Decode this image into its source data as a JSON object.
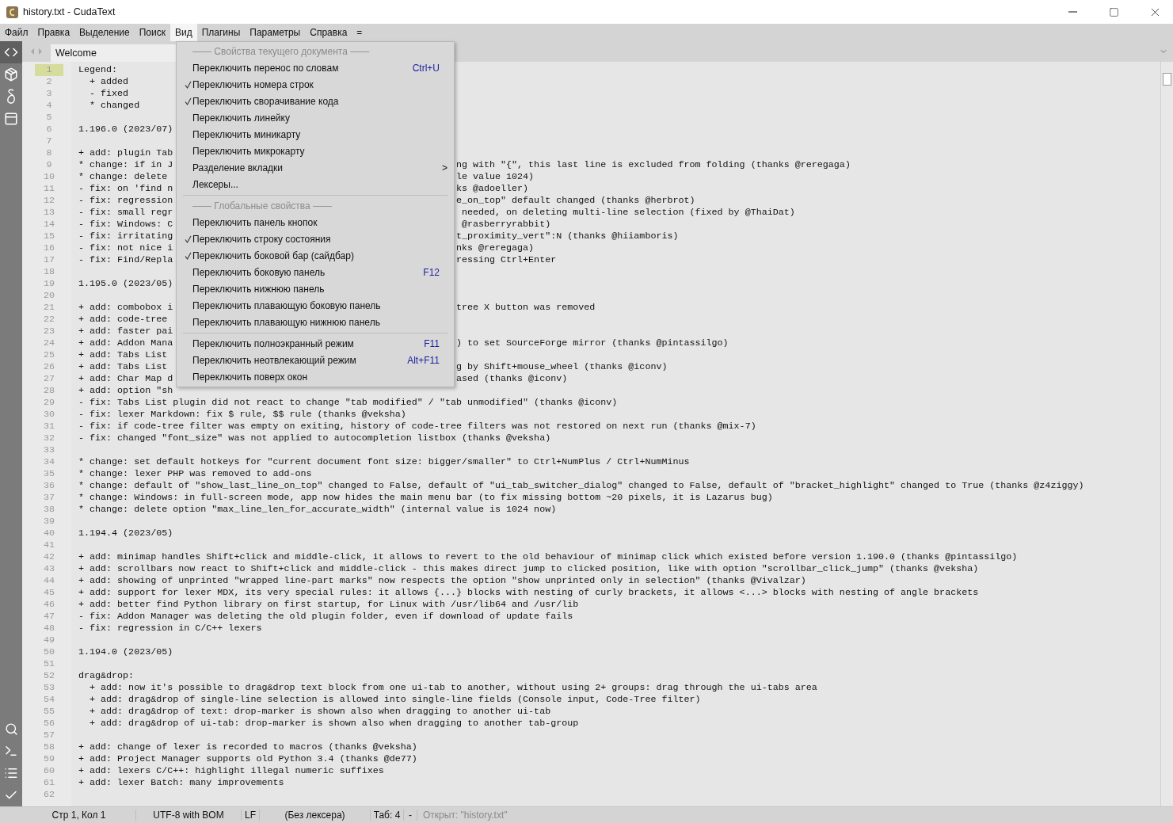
{
  "window": {
    "title": "history.txt - CudaText"
  },
  "menu_bar": [
    {
      "label": "Файл",
      "selected": false
    },
    {
      "label": "Правка",
      "selected": false
    },
    {
      "label": "Выделение",
      "selected": false
    },
    {
      "label": "Поиск",
      "selected": false
    },
    {
      "label": "Вид",
      "selected": true
    },
    {
      "label": "Плагины",
      "selected": false
    },
    {
      "label": "Параметры",
      "selected": false
    },
    {
      "label": "Справка",
      "selected": false
    },
    {
      "label": "=",
      "selected": false
    }
  ],
  "tabs": [
    {
      "label": "Welcome",
      "selected": true
    }
  ],
  "lines": [
    {
      "number": "1",
      "text": "Legend:",
      "current": true
    },
    {
      "number": "2",
      "text": "  + added",
      "current": false
    },
    {
      "number": "3",
      "text": "  - fixed",
      "current": false
    },
    {
      "number": "4",
      "text": "  * changed",
      "current": false
    },
    {
      "number": "5",
      "current": false
    },
    {
      "number": "6",
      "text": "1.196.0 (2023/07)",
      "current": false
    },
    {
      "number": "7",
      "current": false
    },
    {
      "number": "8",
      "text": "+ add: plugin Tab",
      "current": false
    },
    {
      "number": "9",
      "text": "* change: if in J",
      "tail": "ng with \"{\", this last line is excluded from folding (thanks @reregaga)",
      "current": false
    },
    {
      "number": "10",
      "text": "* change: delete",
      "tail": "le value 1024)",
      "current": false
    },
    {
      "number": "11",
      "text": "- fix: on 'find n",
      "tail": "ks @adoeller)",
      "current": false
    },
    {
      "number": "12",
      "text": "- fix: regression",
      "tail": "e_on_top\" default changed (thanks @herbrot)",
      "current": false
    },
    {
      "number": "13",
      "text": "- fix: small regr",
      "tail": " needed, on deleting multi-line selection (fixed by @ThaiDat)",
      "current": false
    },
    {
      "number": "14",
      "text": "- fix: Windows: C",
      "tail": " @rasberryrabbit)",
      "current": false
    },
    {
      "number": "15",
      "text": "- fix: irritating",
      "tail": "t_proximity_vert\":N (thanks @hiiamboris)",
      "current": false
    },
    {
      "number": "16",
      "text": "- fix: not nice i",
      "tail": "nks @reregaga)",
      "current": false
    },
    {
      "number": "17",
      "text": "- fix: Find/Repla",
      "tail": "ressing Ctrl+Enter",
      "current": false
    },
    {
      "number": "18",
      "current": false
    },
    {
      "number": "19",
      "text": "1.195.0 (2023/05)",
      "current": false
    },
    {
      "number": "20",
      "current": false
    },
    {
      "number": "21",
      "text": "+ add: combobox i",
      "tail": "tree X button was removed",
      "current": false
    },
    {
      "number": "22",
      "text": "+ add: code-tree",
      "current": false
    },
    {
      "number": "23",
      "text": "+ add: faster pai",
      "current": false
    },
    {
      "number": "24",
      "text": "+ add: Addon Mana",
      "tail": ") to set SourceForge mirror (thanks @pintassilgo)",
      "current": false
    },
    {
      "number": "25",
      "text": "+ add: Tabs List",
      "current": false
    },
    {
      "number": "26",
      "text": "+ add: Tabs List",
      "tail": "g by Shift+mouse_wheel (thanks @iconv)",
      "current": false
    },
    {
      "number": "27",
      "text": "+ add: Char Map d",
      "tail": "ased (thanks @iconv)",
      "current": false
    },
    {
      "number": "28",
      "text": "+ add: option \"sh",
      "current": false
    },
    {
      "number": "29",
      "text": "- fix: Tabs List plugin did not react to change \"tab modified\" / \"tab unmodified\" (thanks @iconv)",
      "current": false
    },
    {
      "number": "30",
      "text": "- fix: lexer Markdown: fix $ rule, $$ rule (thanks @veksha)",
      "current": false
    },
    {
      "number": "31",
      "text": "- fix: if code-tree filter was empty on exiting, history of code-tree filters was not restored on next run (thanks @mix-7)",
      "current": false
    },
    {
      "number": "32",
      "text": "- fix: changed \"font_size\" was not applied to autocompletion listbox (thanks @veksha)",
      "current": false
    },
    {
      "number": "33",
      "current": false
    },
    {
      "number": "34",
      "text": "* change: set default hotkeys for \"current document font size: bigger/smaller\" to Ctrl+NumPlus / Ctrl+NumMinus",
      "current": false
    },
    {
      "number": "35",
      "text": "* change: lexer PHP was removed to add-ons",
      "current": false
    },
    {
      "number": "36",
      "text": "* change: default of \"show_last_line_on_top\" changed to False, default of \"ui_tab_switcher_dialog\" changed to False, default of \"bracket_highlight\" changed to True (thanks @z4ziggy)",
      "current": false
    },
    {
      "number": "37",
      "text": "* change: Windows: in full-screen mode, app now hides the main menu bar (to fix missing bottom ~20 pixels, it is Lazarus bug)",
      "current": false
    },
    {
      "number": "38",
      "text": "* change: delete option \"max_line_len_for_accurate_width\" (internal value is 1024 now)",
      "current": false
    },
    {
      "number": "39",
      "current": false
    },
    {
      "number": "40",
      "text": "1.194.4 (2023/05)",
      "current": false
    },
    {
      "number": "41",
      "current": false
    },
    {
      "number": "42",
      "text": "+ add: minimap handles Shift+click and middle-click, it allows to revert to the old behaviour of minimap click which existed before version 1.190.0 (thanks @pintassilgo)",
      "current": false
    },
    {
      "number": "43",
      "text": "+ add: scrollbars now react to Shift+click and middle-click - this makes direct jump to clicked position, like with option \"scrollbar_click_jump\" (thanks @veksha)",
      "current": false
    },
    {
      "number": "44",
      "text": "+ add: showing of unprinted \"wrapped line-part marks\" now respects the option \"show unprinted only in selection\" (thanks @Vivalzar)",
      "current": false
    },
    {
      "number": "45",
      "text": "+ add: support for lexer MDX, its very special rules: it allows {...} blocks with nesting of curly brackets, it allows <...> blocks with nesting of angle brackets",
      "current": false
    },
    {
      "number": "46",
      "text": "+ add: better find Python library on first startup, for Linux with /usr/lib64 and /usr/lib",
      "current": false
    },
    {
      "number": "47",
      "text": "- fix: Addon Manager was deleting the old plugin folder, even if download of update fails",
      "current": false
    },
    {
      "number": "48",
      "text": "- fix: regression in C/C++ lexers",
      "current": false
    },
    {
      "number": "49",
      "current": false
    },
    {
      "number": "50",
      "text": "1.194.0 (2023/05)",
      "current": false
    },
    {
      "number": "51",
      "current": false
    },
    {
      "number": "52",
      "text": "drag&drop:",
      "current": false
    },
    {
      "number": "53",
      "text": "  + add: now it's possible to drag&drop text block from one ui-tab to another, without using 2+ groups: drag through the ui-tabs area",
      "current": false
    },
    {
      "number": "54",
      "text": "  + add: drag&drop of single-line selection is allowed into single-line fields (Console input, Code-Tree filter)",
      "current": false
    },
    {
      "number": "55",
      "text": "  + add: drag&drop of text: drop-marker is shown also when dragging to another ui-tab",
      "current": false
    },
    {
      "number": "56",
      "text": "  + add: drag&drop of ui-tab: drop-marker is shown also when dragging to another tab-group",
      "current": false
    },
    {
      "number": "57",
      "current": false
    },
    {
      "number": "58",
      "text": "+ add: change of lexer is recorded to macros (thanks @veksha)",
      "current": false
    },
    {
      "number": "59",
      "text": "+ add: Project Manager supports old Python 3.4 (thanks @de77)",
      "current": false
    },
    {
      "number": "60",
      "text": "+ add: lexers C/C++: highlight illegal numeric suffixes",
      "current": false
    },
    {
      "number": "61",
      "text": "+ add: lexer Batch: many improvements",
      "current": false
    },
    {
      "number": "62",
      "current": false
    }
  ],
  "dropdown": [
    {
      "kind": "header",
      "label": "—— Свойства текущего документа ——"
    },
    {
      "kind": "item",
      "label": "Переключить перенос по словам",
      "shortcut": "Ctrl+U",
      "checked": false
    },
    {
      "kind": "item",
      "label": "Переключить номера строк",
      "checked": true
    },
    {
      "kind": "item",
      "label": "Переключить сворачивание кода",
      "checked": true
    },
    {
      "kind": "item",
      "label": "Переключить линейку",
      "checked": false
    },
    {
      "kind": "item",
      "label": "Переключить миникарту",
      "checked": false
    },
    {
      "kind": "item",
      "label": "Переключить микрокарту",
      "checked": false
    },
    {
      "kind": "item",
      "label": "Разделение вкладки",
      "arrow": ">",
      "checked": false
    },
    {
      "kind": "item",
      "label": "Лексеры...",
      "checked": false
    },
    {
      "kind": "separator"
    },
    {
      "kind": "header",
      "label": "—— Глобальные свойства ——"
    },
    {
      "kind": "item",
      "label": "Переключить панель кнопок",
      "checked": false
    },
    {
      "kind": "item",
      "label": "Переключить строку состояния",
      "checked": true
    },
    {
      "kind": "item",
      "label": "Переключить боковой бар (сайдбар)",
      "checked": true
    },
    {
      "kind": "item",
      "label": "Переключить боковую панель",
      "shortcut": "F12",
      "checked": false
    },
    {
      "kind": "item",
      "label": "Переключить нижнюю панель",
      "checked": false
    },
    {
      "kind": "item",
      "label": "Переключить плавающую боковую панель",
      "checked": false
    },
    {
      "kind": "item",
      "label": "Переключить плавающую нижнюю панель",
      "checked": false
    },
    {
      "kind": "separator"
    },
    {
      "kind": "item",
      "label": "Переключить полноэкранный режим",
      "shortcut": "F11",
      "checked": false
    },
    {
      "kind": "item",
      "label": "Переключить неотвлекающий режим",
      "shortcut": "Alt+F11",
      "checked": false
    },
    {
      "kind": "item",
      "label": "Переключить поверх окон",
      "checked": false
    }
  ],
  "status_bar": [
    {
      "text": "Стр 1, Кол 1",
      "dimmed": false
    },
    {
      "text": "UTF-8 with BOM",
      "dimmed": false
    },
    {
      "text": "LF",
      "dimmed": false
    },
    {
      "text": "(Без лексера)",
      "dimmed": false
    },
    {
      "text": "Таб: 4",
      "dimmed": false
    },
    {
      "text": "-",
      "dimmed": false
    },
    {
      "text": "Открыт: \"history.txt\"",
      "dimmed": true
    }
  ]
}
